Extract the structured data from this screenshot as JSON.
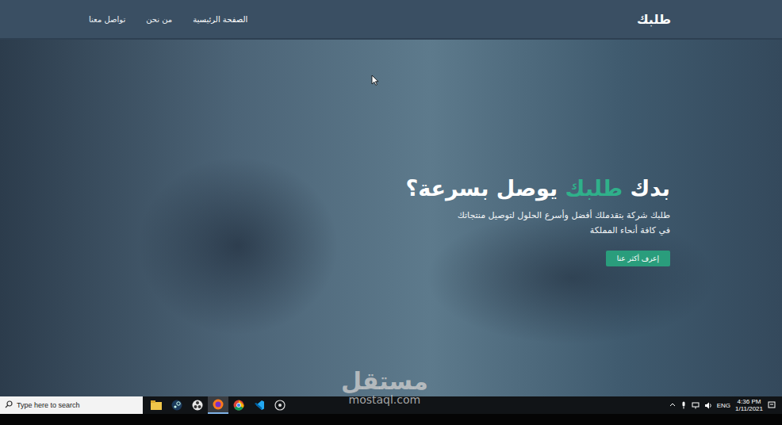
{
  "navbar": {
    "logo": "طلبك",
    "links": [
      {
        "label": "الصفحة الرئيسية",
        "selected": true
      },
      {
        "label": "من نحن",
        "selected": false
      },
      {
        "label": "تواصل معنا",
        "selected": false
      }
    ]
  },
  "hero": {
    "title": {
      "before": "بدك ",
      "highlight": "طلبك",
      "after": " يوصل بسرعة؟"
    },
    "paragraph": [
      "طلبك شركة بتقدملك أفضل وأسرع الحلول لتوصيل منتجاتك",
      "في كافة أنحاء المملكة"
    ],
    "button": "إعرف أكثر عنا"
  },
  "taskbar": {
    "search": "Type here to search",
    "apps": [
      {
        "kind": "folder",
        "selected": false
      },
      {
        "kind": "steam",
        "selected": false
      },
      {
        "kind": "obs",
        "selected": false
      },
      {
        "kind": "firefox",
        "selected": true
      },
      {
        "kind": "chrome",
        "selected": false
      },
      {
        "kind": "vscode",
        "selected": false
      },
      {
        "kind": "disc",
        "selected": false
      }
    ],
    "tray": {
      "language": "ENG",
      "time": "4:36 PM",
      "date": "1/11/2021"
    }
  },
  "watermark": {
    "arabic": "مستقل",
    "latin": "mostaql.com"
  }
}
